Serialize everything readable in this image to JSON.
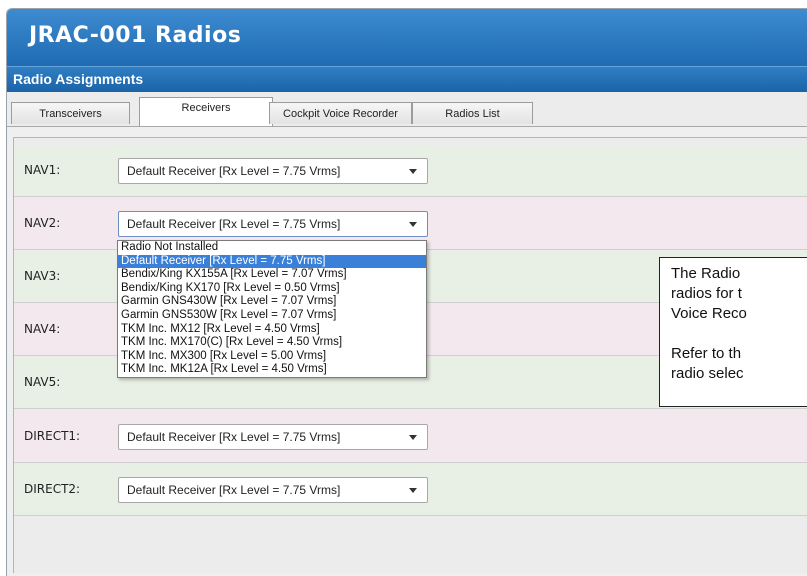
{
  "app": {
    "title": "JRAC-001 Radios"
  },
  "section": {
    "title": "Radio Assignments"
  },
  "tabs": [
    {
      "label": "Transceivers"
    },
    {
      "label": "Receivers"
    },
    {
      "label": "Cockpit Voice Recorder"
    },
    {
      "label": "Radios List"
    }
  ],
  "active_tab": "Receivers",
  "rows": [
    {
      "label": "NAV1:",
      "value": "Default Receiver  [Rx Level = 7.75 Vrms]"
    },
    {
      "label": "NAV2:",
      "value": "Default Receiver  [Rx Level = 7.75 Vrms]"
    },
    {
      "label": "NAV3:",
      "value": ""
    },
    {
      "label": "NAV4:",
      "value": ""
    },
    {
      "label": "NAV5:",
      "value": ""
    },
    {
      "label": "DIRECT1:",
      "value": "Default Receiver  [Rx Level = 7.75 Vrms]"
    },
    {
      "label": "DIRECT2:",
      "value": "Default Receiver  [Rx Level = 7.75 Vrms]"
    }
  ],
  "dropdown": {
    "options": [
      "Radio Not Installed",
      "Default Receiver  [Rx Level = 7.75 Vrms]",
      "Bendix/King KX155A [Rx Level = 7.07 Vrms]",
      "Bendix/King KX170 [Rx Level = 0.50 Vrms]",
      "Garmin GNS430W [Rx Level = 7.07 Vrms]",
      "Garmin GNS530W [Rx Level = 7.07 Vrms]",
      "TKM Inc. MX12 [Rx Level = 4.50 Vrms]",
      "TKM Inc. MX170(C) [Rx Level = 4.50 Vrms]",
      "TKM Inc. MX300 [Rx Level = 5.00 Vrms]",
      "TKM Inc. MK12A [Rx Level = 4.50 Vrms]"
    ],
    "selected_index": 1
  },
  "note": {
    "lines1": [
      "The Radio",
      "radios for t",
      "Voice Reco"
    ],
    "lines2": [
      "Refer to th",
      "radio selec"
    ]
  },
  "colors": {
    "title_bar": "#2a78c0",
    "row_green": "#e8efe4",
    "row_pink": "#f3e8ee",
    "selected_option": "#3a80d8"
  }
}
